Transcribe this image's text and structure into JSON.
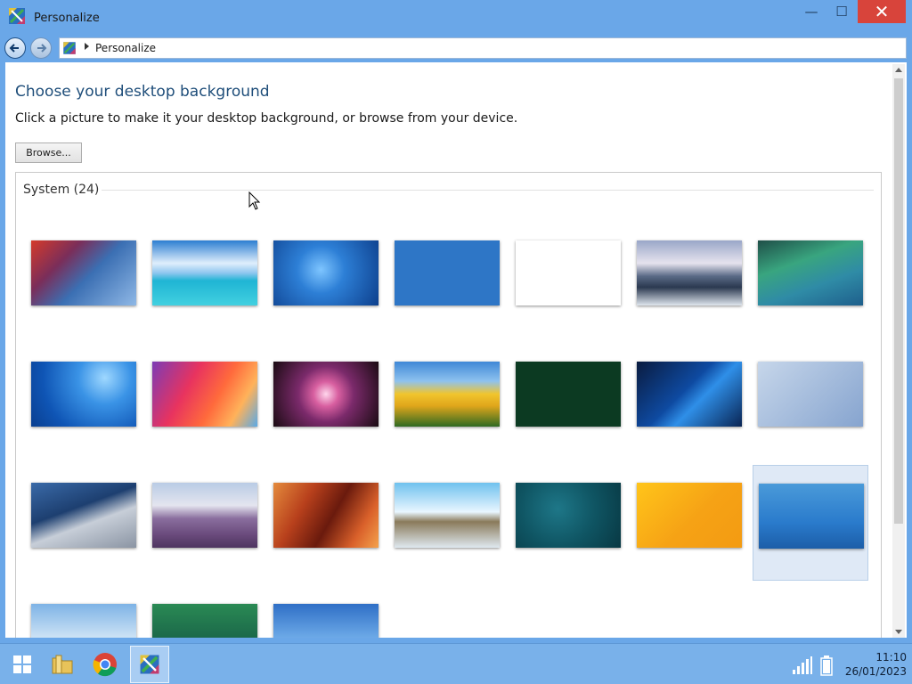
{
  "window": {
    "title": "Personalize",
    "minimize_glyph": "—",
    "maximize_glyph": "☐",
    "close_glyph": "✕"
  },
  "address": {
    "path": "Personalize"
  },
  "main": {
    "heading": "Choose your desktop background",
    "instruction": "Click a picture to make it your desktop background, or browse from your device.",
    "browse_label": "Browse...",
    "group_label": "System (24)"
  },
  "wallpapers": [
    {
      "name": "seattle-space-needle"
    },
    {
      "name": "tropical-beach"
    },
    {
      "name": "windows-7"
    },
    {
      "name": "goldfish"
    },
    {
      "name": "suitcase"
    },
    {
      "name": "icy-lake-sunset"
    },
    {
      "name": "aurora"
    },
    {
      "name": "windows-8-blue"
    },
    {
      "name": "macos-big-sur"
    },
    {
      "name": "purple-dahlia"
    },
    {
      "name": "yellow-tulips"
    },
    {
      "name": "water-lilies"
    },
    {
      "name": "windows-10-hero"
    },
    {
      "name": "windows-11-bloom"
    },
    {
      "name": "selfridges-building"
    },
    {
      "name": "lavender-field"
    },
    {
      "name": "red-canyon"
    },
    {
      "name": "flying-island"
    },
    {
      "name": "teal-abstract"
    },
    {
      "name": "windows-8-yellow"
    },
    {
      "name": "daisies",
      "selected": true
    },
    {
      "name": "clouds"
    },
    {
      "name": "green-aurora"
    },
    {
      "name": "blue-sky"
    }
  ],
  "taskbar": {
    "items": [
      "start",
      "file-explorer",
      "chrome",
      "personalize"
    ],
    "active": "personalize",
    "time": "11:10",
    "date": "26/01/2023"
  },
  "colors": {
    "titlebar": "#6aa7e8",
    "taskbar": "#79b1ea",
    "close_button": "#d8443b",
    "heading": "#1f4e7a",
    "selection": "#dfe9f6"
  }
}
